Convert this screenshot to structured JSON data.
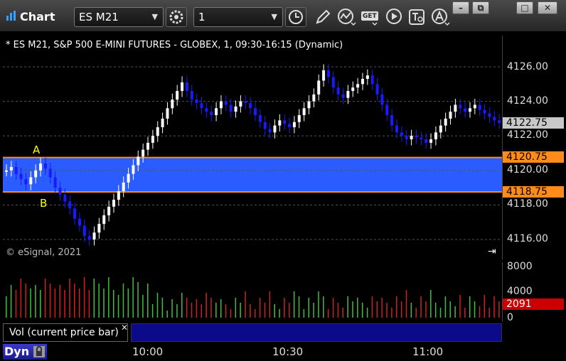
{
  "window": {
    "title": "Chart",
    "min_icon": "minimize-icon",
    "restore_icon": "restore-icon",
    "max_icon": "maximize-icon",
    "close_icon": "close-icon"
  },
  "toolbar": {
    "symbol": "ES M21",
    "interval": "1",
    "buttons": [
      "settings-gear-icon",
      "clock-icon",
      "pencil-draw-icon",
      "study-wave-icon",
      "get-data-icon",
      "play-icon",
      "text-tool-icon",
      "alert-icon"
    ],
    "get_label": "GET"
  },
  "chart": {
    "caption": "* ES M21, S&P 500 E-MINI FUTURES - GLOBEX, 1, 09:30-16:15 (Dynamic)",
    "watermark": "© eSignal, 2021",
    "label_a": "A",
    "label_b": "B",
    "colors": {
      "up": "#ffffff",
      "down": "#1a1aff",
      "zone": "#2b5cff",
      "zone_line": "#ff8c1a",
      "bg": "#000000"
    },
    "price_labels": [
      "4126.00",
      "4124.00",
      "4122.00",
      "4120.00",
      "4118.00",
      "4116.00"
    ],
    "last_price": "4122.75",
    "zone_top": "4120.75",
    "zone_bottom": "4118.75"
  },
  "volume": {
    "panel_label": "Vol (current price bar)",
    "axis_labels": [
      "8000",
      "4000",
      "0"
    ],
    "last_volume": "2091"
  },
  "time_axis": {
    "labels": [
      "10:00",
      "10:30",
      "11:00"
    ]
  },
  "status": {
    "dyn_label": "Dyn"
  }
}
